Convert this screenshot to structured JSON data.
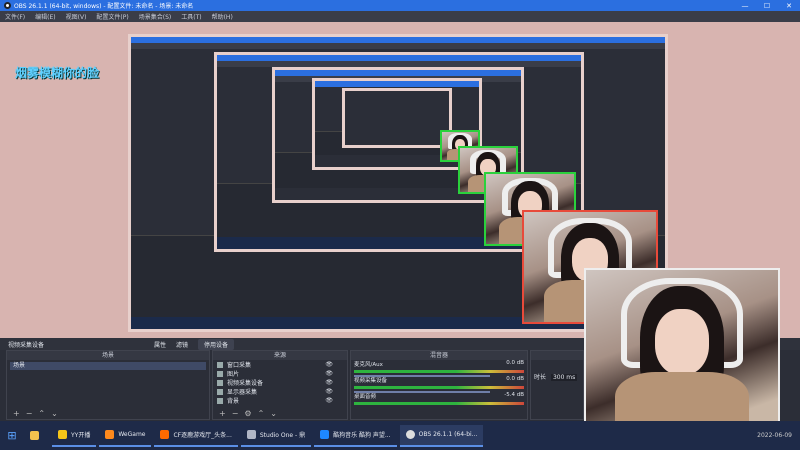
{
  "window": {
    "title": "OBS 26.1.1 (64-bit, windows) - 配置文件: 未命名 - 场景: 未命名"
  },
  "menu": [
    "文件(F)",
    "编辑(E)",
    "视图(V)",
    "配置文件(P)",
    "场景集合(S)",
    "工具(T)",
    "帮助(H)"
  ],
  "preview": {
    "overlay_text": "烟雾模糊你的脸"
  },
  "controls": {
    "device_label": "视频采集设备",
    "properties": "属性",
    "filters": "滤镜",
    "deactivate": "停用设备"
  },
  "scenes": {
    "header": "场景",
    "items": [
      "场景"
    ]
  },
  "sources": {
    "header": "来源",
    "items": [
      "窗口采集",
      "图片",
      "视频采集设备",
      "显示器采集",
      "背景"
    ]
  },
  "mixer": {
    "header": "混音器",
    "channels": [
      {
        "name": "麦克风/Aux",
        "db": "0.0 dB"
      },
      {
        "name": "视频采集设备",
        "db": "0.0 dB"
      },
      {
        "name": "桌面音频",
        "db": "-5.4 dB"
      }
    ]
  },
  "transitions": {
    "label": "时长",
    "duration": "300 ms"
  },
  "taskbar": {
    "items": [
      {
        "label": "YY开播",
        "color": "#f5c518"
      },
      {
        "label": "WeGame",
        "color": "#ff8a1c"
      },
      {
        "label": "CF逐鹿游戏厅_头条...",
        "color": "#ff6a00"
      },
      {
        "label": "Studio One - 鼎",
        "color": "#b0b6c6"
      },
      {
        "label": "酷狗音乐 酷狗 声望...",
        "color": "#1e88ff"
      },
      {
        "label": "OBS 26.1.1 (64-bi...",
        "color": "#dddddd"
      }
    ],
    "clock": "2022-06-09"
  }
}
